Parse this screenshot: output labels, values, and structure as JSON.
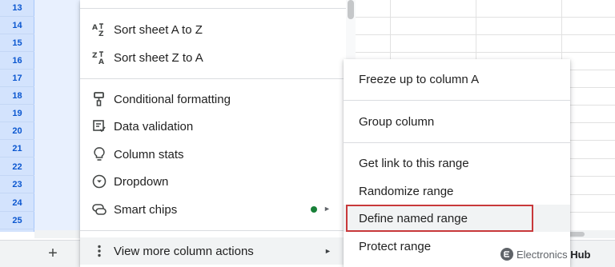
{
  "row_numbers": [
    "13",
    "14",
    "15",
    "16",
    "17",
    "18",
    "19",
    "20",
    "21",
    "22",
    "23",
    "24",
    "25"
  ],
  "menu": {
    "items": [
      {
        "label": "Sort sheet A to Z",
        "icon": "sort-az-icon"
      },
      {
        "label": "Sort sheet Z to A",
        "icon": "sort-za-icon"
      },
      {
        "label": "Conditional formatting",
        "icon": "paint-roller-icon"
      },
      {
        "label": "Data validation",
        "icon": "data-validation-icon"
      },
      {
        "label": "Column stats",
        "icon": "lightbulb-icon"
      },
      {
        "label": "Dropdown",
        "icon": "dropdown-icon"
      },
      {
        "label": "Smart chips",
        "icon": "smart-chips-icon"
      },
      {
        "label": "View more column actions",
        "icon": "more-vert-icon"
      }
    ],
    "sort_az_glyph": "A͟Z",
    "sort_za_glyph": "Z͟A"
  },
  "submenu": {
    "items": [
      {
        "label": "Freeze up to column A"
      },
      {
        "label": "Group column"
      },
      {
        "label": "Get link to this range"
      },
      {
        "label": "Randomize range"
      },
      {
        "label": "Define named range"
      },
      {
        "label": "Protect range"
      }
    ],
    "highlighted_index": 4
  },
  "bottom_bar": {
    "add_sheet_label": "+"
  },
  "watermark": {
    "brand": "Electronics",
    "brand_bold": "Hub"
  },
  "colors": {
    "accent_red": "#c8383a",
    "green_dot": "#188038",
    "row_header_bg": "#d3e3fd"
  }
}
